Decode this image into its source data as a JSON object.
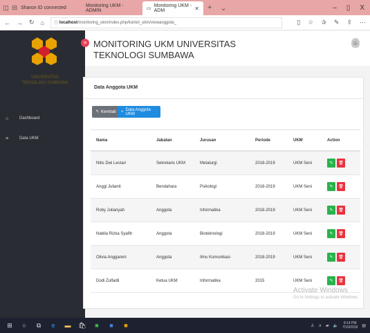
{
  "browser": {
    "tab_left_label": "Sharon ID connected",
    "tabs": [
      {
        "label": "Monitoring UKM - ADMIN"
      },
      {
        "label": "Monitoring UKM - ADM"
      }
    ],
    "url_host": "localhost",
    "url_path": "/monitoring_ukm/index.php/kontol_ukm/viewanggota_",
    "window_controls": {
      "min": "–",
      "max": "▯",
      "close": "X"
    }
  },
  "sidebar": {
    "brand_text": "UNIVERSITAS TEKNOLOGI SUMBAWA",
    "items": [
      {
        "label": "Dashboard",
        "icon": "home-icon"
      },
      {
        "label": "Data UKM",
        "icon": "list-icon"
      }
    ]
  },
  "header": {
    "title": "MONITORING UKM UNIVERSITAS TEKNOLOGI SUMBAWA"
  },
  "card": {
    "title": "Data Anggota UKM",
    "back_label": "Kembali",
    "add_label": "Data Anggota UKM"
  },
  "table": {
    "columns": [
      "Nama",
      "Jabatan",
      "Jurusan",
      "Periode",
      "UKM",
      "Action"
    ],
    "rows": [
      [
        "Nitis Dwi Lestari",
        "Sekretaris UKM",
        "Metalurgi",
        "2018-2019",
        "UKM Seni"
      ],
      [
        "Anggi Julianti",
        "Bendahara",
        "Psikologi",
        "2018-2019",
        "UKM Seni"
      ],
      [
        "Roby Julianyah",
        "Anggota",
        "Informatika",
        "2018-2019",
        "UKM Seni"
      ],
      [
        "Nabila Rizka Syafitr",
        "Anggota",
        "Bioteknologi",
        "2018-2019",
        "UKM Seni"
      ],
      [
        "Olivia Anggareni",
        "Anggota",
        "Ilmu Komunikasi",
        "2018-2019",
        "UKM Seni"
      ],
      [
        "Dodi Zulfadli",
        "Ketua UKM",
        "Informatika",
        "2015",
        "UKM Seni"
      ]
    ]
  },
  "watermark": {
    "line1": "Activate Windows",
    "line2": "Go to Settings to activate Windows."
  },
  "taskbar": {
    "time": "9:14 PM",
    "date": "7/19/2019"
  }
}
